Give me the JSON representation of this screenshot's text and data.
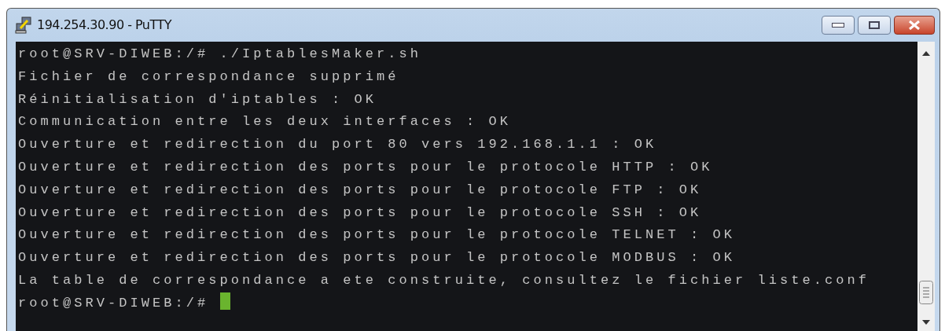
{
  "window": {
    "title": "194.254.30.90 - PuTTY"
  },
  "terminal": {
    "lines": [
      "root@SRV-DIWEB:/# ./IptablesMaker.sh",
      "Fichier de correspondance supprimé",
      "Réinitialisation d'iptables : OK",
      "Communication entre les deux interfaces : OK",
      "Ouverture et redirection du port 80 vers 192.168.1.1 : OK",
      "Ouverture et redirection des ports pour le protocole HTTP : OK",
      "Ouverture et redirection des ports pour le protocole FTP : OK",
      "Ouverture et redirection des ports pour le protocole SSH : OK",
      "Ouverture et redirection des ports pour le protocole TELNET : OK",
      "Ouverture et redirection des ports pour le protocole MODBUS : OK",
      "La table de correspondance a ete construite, consultez le fichier liste.conf"
    ],
    "prompt": "root@SRV-DIWEB:/#",
    "cursor": true
  }
}
